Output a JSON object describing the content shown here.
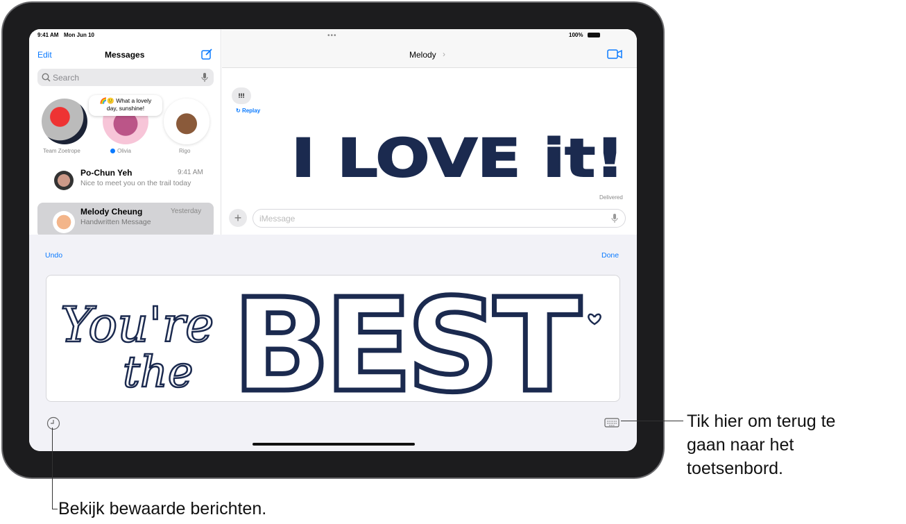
{
  "status_bar": {
    "time": "9:41 AM",
    "date": "Mon Jun 10",
    "battery": "100%"
  },
  "sidebar": {
    "edit": "Edit",
    "title": "Messages",
    "search_placeholder": "Search",
    "pinned": [
      {
        "name": "Team Zoetrope"
      },
      {
        "name": "Olivia",
        "unread": true,
        "bubble": "🌈🙂 What a lovely day, sunshine!"
      },
      {
        "name": "Rigo"
      }
    ],
    "conversations": [
      {
        "name": "Po-Chun Yeh",
        "time": "9:41 AM",
        "preview": "Nice to meet you on the trail today"
      },
      {
        "name": "Melody Cheung",
        "time": "Yesterday",
        "preview": "Handwritten Message",
        "selected": true
      }
    ]
  },
  "chat": {
    "contact": "Melody",
    "bubble": "!!!",
    "replay": "Replay",
    "handwriting": "I LOVE it!",
    "status": "Delivered",
    "input_placeholder": "iMessage"
  },
  "handwriting_panel": {
    "undo": "Undo",
    "done": "Done",
    "drawing": "You're the BEST"
  },
  "callouts": {
    "keyboard": "Tik hier om terug te gaan naar het toetsenbord.",
    "saved": "Bekijk bewaarde berichten."
  },
  "colors": {
    "accent": "#0a7aff",
    "ink": "#1b2a4f"
  }
}
